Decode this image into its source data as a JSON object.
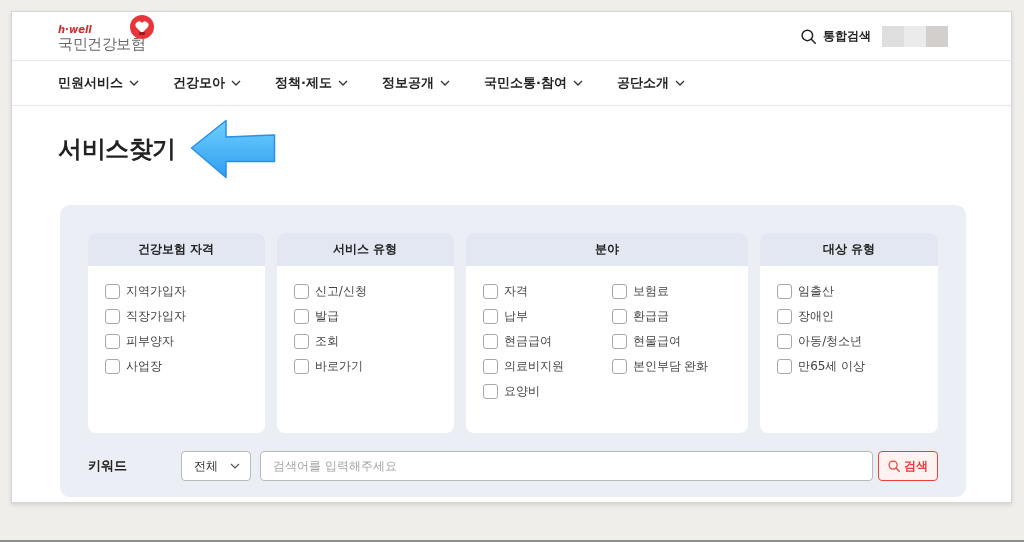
{
  "header": {
    "logo_tagline": "h·well",
    "logo_name": "국민건강보험",
    "search_link": "통합검색"
  },
  "nav": [
    {
      "label": "민원서비스"
    },
    {
      "label": "건강모아"
    },
    {
      "label": "정책·제도"
    },
    {
      "label": "정보공개"
    },
    {
      "label": "국민소통·참여"
    },
    {
      "label": "공단소개"
    }
  ],
  "page_title": "서비스찾기",
  "filters": [
    {
      "title": "건강보험 자격",
      "kind": "list",
      "options": [
        {
          "label": "지역가입자",
          "checked": false
        },
        {
          "label": "직장가입자",
          "checked": false
        },
        {
          "label": "피부양자",
          "checked": false
        },
        {
          "label": "사업장",
          "checked": false
        }
      ]
    },
    {
      "title": "서비스 유형",
      "kind": "list",
      "options": [
        {
          "label": "신고/신청",
          "checked": false
        },
        {
          "label": "발급",
          "checked": false
        },
        {
          "label": "조회",
          "checked": false
        },
        {
          "label": "바로가기",
          "checked": false
        }
      ]
    },
    {
      "title": "분야",
      "kind": "grid",
      "options": [
        {
          "label": "자격",
          "checked": false
        },
        {
          "label": "보험료",
          "checked": false
        },
        {
          "label": "납부",
          "checked": false
        },
        {
          "label": "환급금",
          "checked": false
        },
        {
          "label": "현금급여",
          "checked": false
        },
        {
          "label": "현물급여",
          "checked": false
        },
        {
          "label": "의료비지원",
          "checked": false
        },
        {
          "label": "본인부담 완화",
          "checked": false
        },
        {
          "label": "요양비",
          "checked": false
        }
      ]
    },
    {
      "title": "대상 유형",
      "kind": "list",
      "options": [
        {
          "label": "임출산",
          "checked": false
        },
        {
          "label": "장애인",
          "checked": false
        },
        {
          "label": "아동/청소년",
          "checked": false
        },
        {
          "label": "만65세 이상",
          "checked": false
        }
      ]
    }
  ],
  "keyword_search": {
    "label": "키워드",
    "scope": "전체",
    "placeholder": "검색어를 입력해주세요",
    "button": "검색"
  }
}
